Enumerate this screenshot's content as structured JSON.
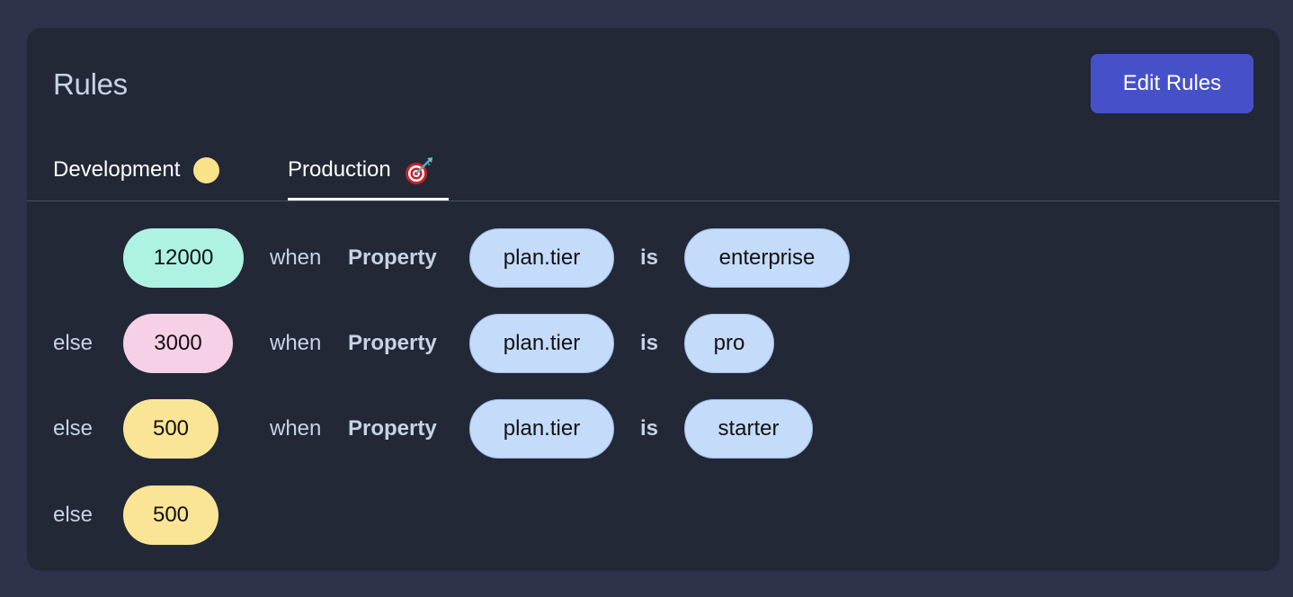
{
  "card": {
    "title": "Rules",
    "edit_button_label": "Edit Rules"
  },
  "tabs": [
    {
      "label": "Development",
      "icon": "yellow-dot-icon",
      "active": false
    },
    {
      "label": "Production",
      "icon": "target-icon",
      "active": true
    }
  ],
  "rules": [
    {
      "prefix": "",
      "value": "12000",
      "value_color": "#aef2e2",
      "when": "when",
      "kind": "Property",
      "attribute": "plan.tier",
      "operator": "is",
      "match": "enterprise"
    },
    {
      "prefix": "else",
      "value": "3000",
      "value_color": "#f5d0e6",
      "when": "when",
      "kind": "Property",
      "attribute": "plan.tier",
      "operator": "is",
      "match": "pro"
    },
    {
      "prefix": "else",
      "value": "500",
      "value_color": "#fae596",
      "when": "when",
      "kind": "Property",
      "attribute": "plan.tier",
      "operator": "is",
      "match": "starter"
    },
    {
      "prefix": "else",
      "value": "500",
      "value_color": "#fae596"
    }
  ],
  "colors": {
    "background": "#2e324a",
    "card": "#222836",
    "accent": "#4651c9",
    "pill_blue": "#c4dbfa"
  }
}
